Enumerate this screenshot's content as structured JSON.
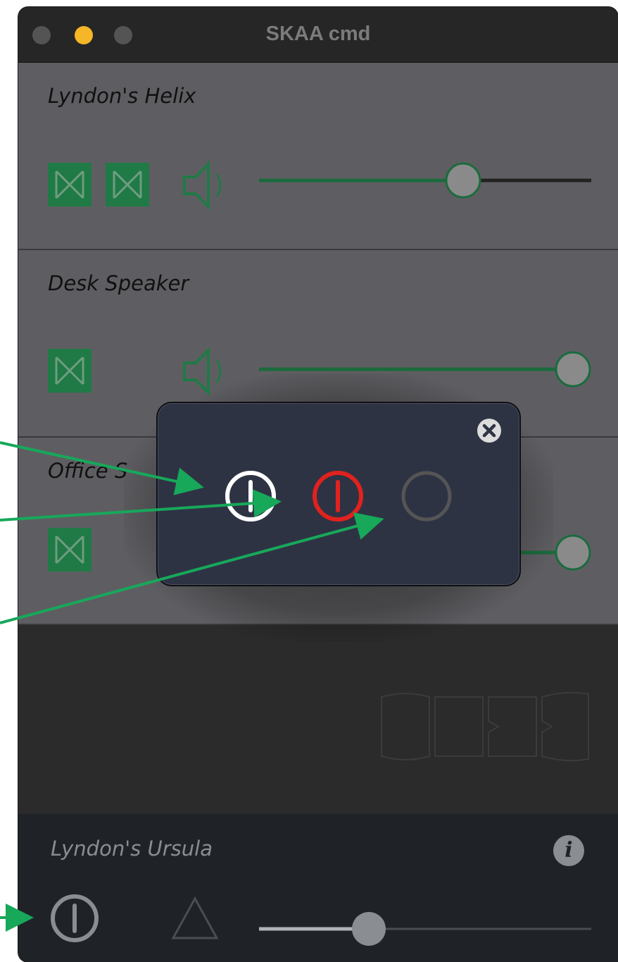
{
  "window": {
    "title": "SKAA cmd",
    "traffic_lights": [
      "close-button",
      "minimize-button",
      "zoom-button"
    ],
    "accent_color": "#1f7a46"
  },
  "speakers": [
    {
      "name": "Lyndon's Helix",
      "channels": 2,
      "volume_percent": 62
    },
    {
      "name": "Desk Speaker",
      "channels": 1,
      "volume_percent": 100
    },
    {
      "name": "Office S",
      "channels": 1,
      "volume_percent": 100
    }
  ],
  "popup": {
    "buttons": [
      {
        "icon": "power-icon",
        "state": "on",
        "color": "#ffffff"
      },
      {
        "icon": "power-icon",
        "state": "off",
        "color": "#e0221e"
      },
      {
        "icon": "ring-icon",
        "state": "disconnected",
        "color": "#555555"
      }
    ],
    "close_icon": "close-circle-icon"
  },
  "transmitter": {
    "name": "Lyndon's Ursula",
    "volume_percent": 34,
    "icons": [
      "power-icon",
      "triangle-icon",
      "info-icon"
    ]
  }
}
